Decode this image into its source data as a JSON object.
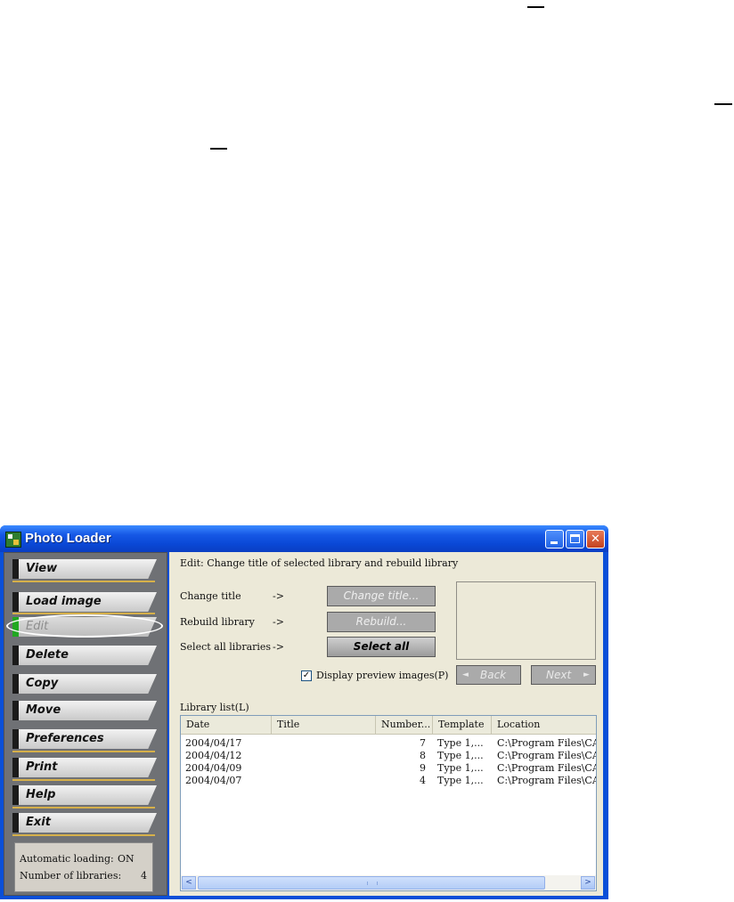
{
  "window": {
    "title": "Photo Loader"
  },
  "window_controls": {
    "minimize_icon": "minimize-icon",
    "maximize_icon": "maximize-icon",
    "close_icon": "close-icon",
    "close_glyph": "✕"
  },
  "sidebar": {
    "items": [
      {
        "label": "View",
        "state": "enabled"
      },
      {
        "label": "Load image",
        "state": "enabled"
      },
      {
        "label": "Edit",
        "state": "selected"
      },
      {
        "label": "Delete",
        "state": "enabled"
      },
      {
        "label": "Copy",
        "state": "enabled"
      },
      {
        "label": "Move",
        "state": "enabled"
      },
      {
        "label": "Preferences",
        "state": "enabled"
      },
      {
        "label": "Print",
        "state": "enabled"
      },
      {
        "label": "Help",
        "state": "enabled"
      },
      {
        "label": "Exit",
        "state": "enabled"
      }
    ],
    "status": {
      "auto_loading_label": "Automatic loading:",
      "auto_loading_value": "ON",
      "libraries_label": "Number of libraries:",
      "libraries_value": "4"
    }
  },
  "main": {
    "description": "Edit: Change title of selected library and rebuild library",
    "actions": [
      {
        "label": "Change title",
        "arrow": "->",
        "button": "Change title...",
        "enabled": false
      },
      {
        "label": "Rebuild library",
        "arrow": "->",
        "button": "Rebuild...",
        "enabled": false
      },
      {
        "label": "Select all libraries",
        "arrow": "->",
        "button": "Select all",
        "enabled": true
      }
    ],
    "preview_checkbox": {
      "label": "Display preview images(P)",
      "checked": true,
      "check_glyph": "✓"
    },
    "back_button": {
      "label": "Back",
      "icon": "◄"
    },
    "next_button": {
      "label": "Next",
      "icon": "►"
    },
    "library_list": {
      "label": "Library list(L)",
      "columns": [
        "Date",
        "Title",
        "Number...",
        "Template",
        "Location"
      ],
      "rows": [
        {
          "date": "2004/04/17",
          "title": "",
          "number": "7",
          "template": "Type 1,...",
          "location": "C:\\Program Files\\CAS"
        },
        {
          "date": "2004/04/12",
          "title": "",
          "number": "8",
          "template": "Type 1,...",
          "location": "C:\\Program Files\\CAS"
        },
        {
          "date": "2004/04/09",
          "title": "",
          "number": "9",
          "template": "Type 1,...",
          "location": "C:\\Program Files\\CAS"
        },
        {
          "date": "2004/04/07",
          "title": "",
          "number": "4",
          "template": "Type 1,...",
          "location": "C:\\Program Files\\CAS"
        }
      ],
      "scroll_left_glyph": "<",
      "scroll_right_glyph": ">"
    }
  },
  "colors": {
    "titlebar": "#0a4fd8",
    "sidebar_bg": "#6f7175",
    "dialog_bg": "#ece9d8",
    "selection_marker": "#21a821",
    "nav_underline": "#d6b04a"
  }
}
